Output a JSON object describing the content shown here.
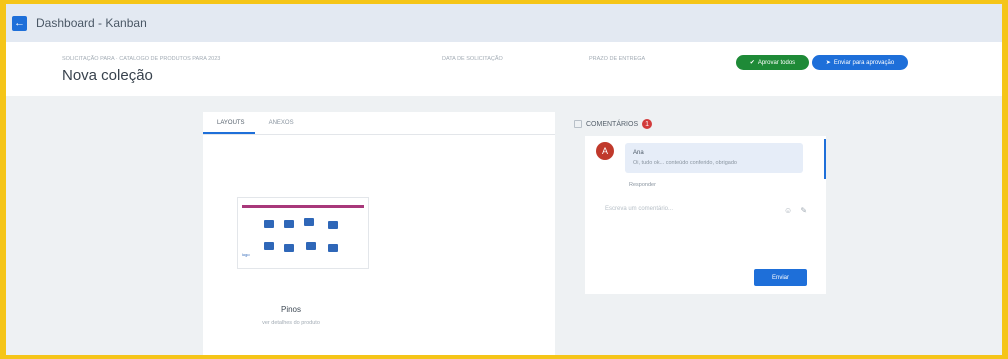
{
  "topbar": {
    "back_icon": "←",
    "breadcrumb": "Dashboard - Kanban"
  },
  "header": {
    "collection_meta": "SOLICITAÇÃO PARA · CATALOGO DE PRODUTOS PARA 2023",
    "meta_middle": "DATA DE SOLICITAÇÃO",
    "meta_right": "PRAZO DE ENTREGA",
    "title": "Nova coleção",
    "approve_label": "Aprovar todos",
    "approve_icon": "✔",
    "forward_label": "Enviar para aprovação",
    "forward_icon": "➤"
  },
  "left_panel": {
    "tabs": [
      "LAYOUTS",
      "ANEXOS"
    ],
    "thumb_logo": "logo",
    "product_name": "Pinos",
    "product_sub": "ver detalhes do produto"
  },
  "comments": {
    "label": "COMENTÁRIOS",
    "count": "1",
    "avatar_initial": "A",
    "author": "Ana",
    "text": "Oi, tudo ok... conteúdo conferido, obrigado",
    "reply": "Responder",
    "input_placeholder": "Escreva um comentário...",
    "input_icons": "☺ ✎",
    "send_label": "Enviar"
  },
  "colors": {
    "accent": "#1e6fd9",
    "approve": "#1e8a37",
    "badge": "#d23b3b"
  }
}
